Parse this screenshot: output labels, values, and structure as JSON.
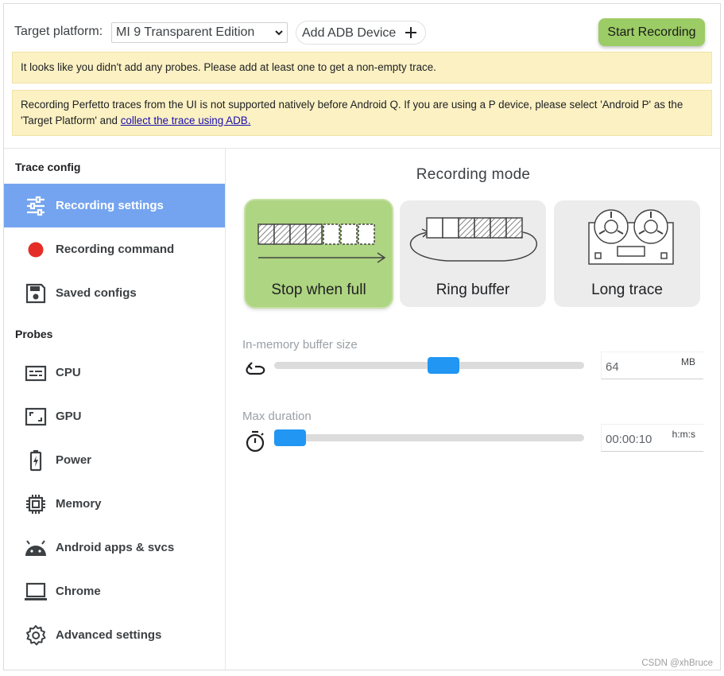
{
  "header": {
    "target_platform_label": "Target platform:",
    "target_platform_value": "MI 9 Transparent Edition",
    "add_adb_device_label": "Add ADB Device",
    "start_recording_label": "Start Recording"
  },
  "warnings": {
    "no_probes": "It looks like you didn't add any probes. Please add at least one to get a non-empty trace.",
    "android_p_text": "Recording Perfetto traces from the UI is not supported natively before Android Q. If you are using a P device, please select 'Android P' as the 'Target Platform' and ",
    "android_p_link": "collect the trace using ADB."
  },
  "sidebar": {
    "trace_config_title": "Trace config",
    "trace_config_items": [
      {
        "label": "Recording settings",
        "icon": "tune-icon",
        "active": true
      },
      {
        "label": "Recording command",
        "icon": "red-dot-icon",
        "active": false
      },
      {
        "label": "Saved configs",
        "icon": "save-icon",
        "active": false
      }
    ],
    "probes_title": "Probes",
    "probe_items": [
      {
        "label": "CPU",
        "icon": "cpu-icon"
      },
      {
        "label": "GPU",
        "icon": "gpu-icon"
      },
      {
        "label": "Power",
        "icon": "battery-icon"
      },
      {
        "label": "Memory",
        "icon": "memory-chip-icon"
      },
      {
        "label": "Android apps & svcs",
        "icon": "android-icon"
      },
      {
        "label": "Chrome",
        "icon": "laptop-icon"
      },
      {
        "label": "Advanced settings",
        "icon": "gear-icon"
      }
    ]
  },
  "main": {
    "recording_mode_title": "Recording mode",
    "modes": [
      {
        "label": "Stop when full",
        "selected": true
      },
      {
        "label": "Ring buffer",
        "selected": false
      },
      {
        "label": "Long trace",
        "selected": false
      }
    ],
    "buffer": {
      "label": "In-memory buffer size",
      "value": "64",
      "unit": "MB",
      "slider_fraction": 0.55
    },
    "duration": {
      "label": "Max duration",
      "value": "00:00:10",
      "unit": "h:m:s",
      "slider_fraction": 0.0
    }
  },
  "colors": {
    "accent_green": "#9ccc65",
    "selected_card": "#aed581",
    "active_nav": "#74a4ef",
    "slider_thumb": "#2196f3",
    "warning_bg": "#fbf1c3",
    "record_dot": "#e52d27"
  },
  "watermark": "CSDN @xhBruce"
}
